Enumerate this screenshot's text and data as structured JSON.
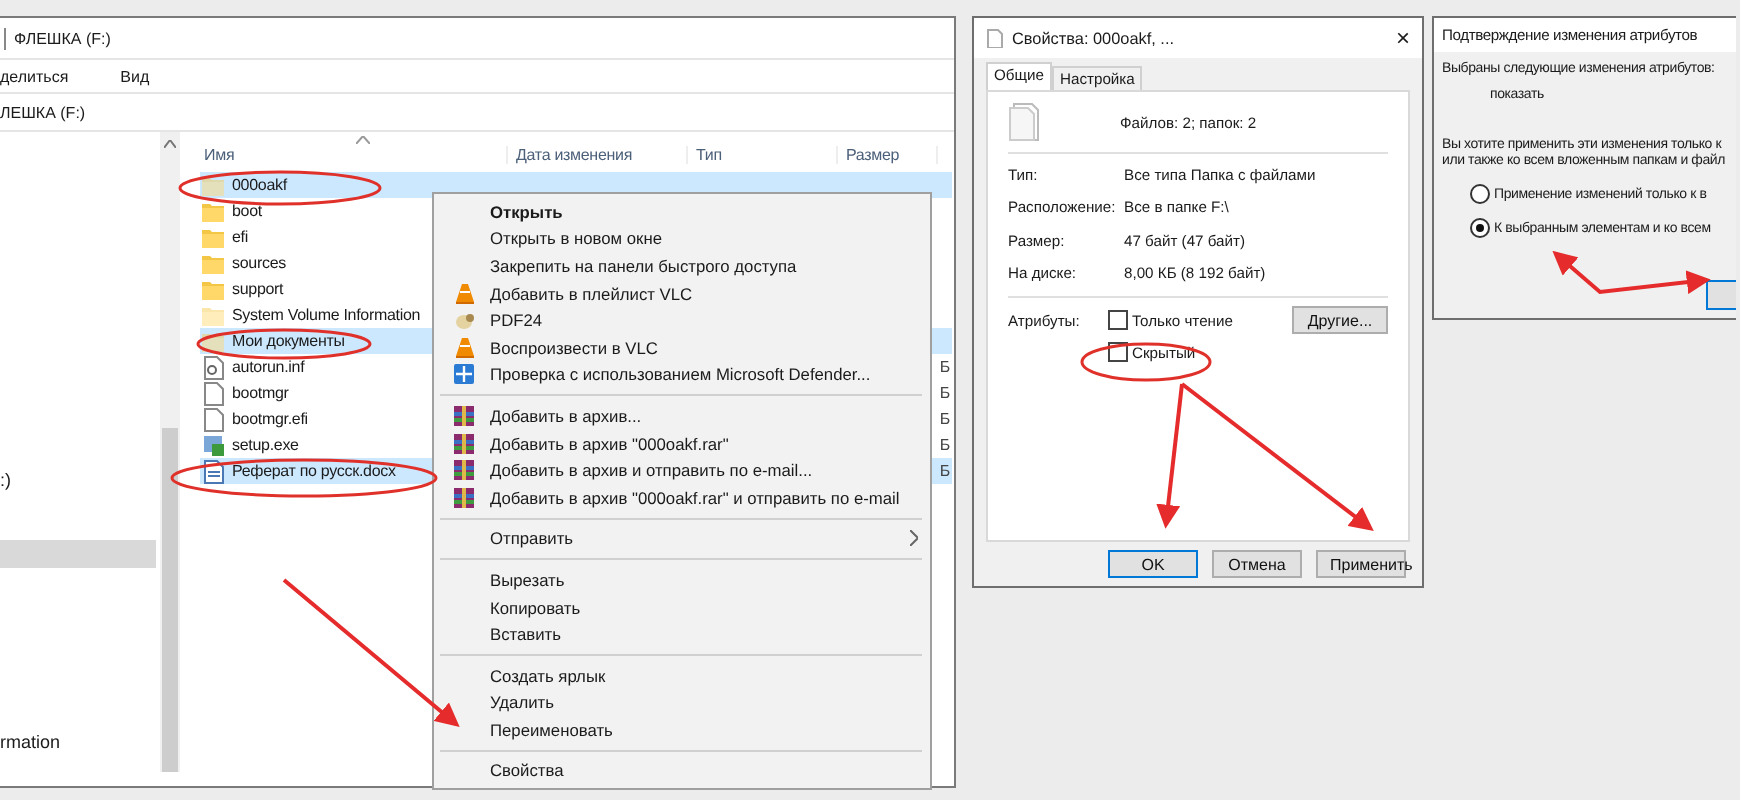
{
  "explorer": {
    "title": "ФЛЕШКА (F:)",
    "ribbon_tabs": [
      "делиться",
      "Вид"
    ],
    "address": "ЛЕШКА (F:)",
    "nav_items": [
      {
        "label": ":)",
        "selected": false
      },
      {
        "selected": true
      },
      {
        "label": "rmation",
        "selected": false
      }
    ],
    "columns": [
      "Имя",
      "Дата изменения",
      "Тип",
      "Размер"
    ],
    "files": [
      {
        "name": "000oakf",
        "kind": "folder",
        "hidden": true,
        "selected": true
      },
      {
        "name": "boot",
        "kind": "folder",
        "hidden": false,
        "selected": false
      },
      {
        "name": "efi",
        "kind": "folder",
        "hidden": false,
        "selected": false
      },
      {
        "name": "sources",
        "kind": "folder",
        "hidden": false,
        "selected": false
      },
      {
        "name": "support",
        "kind": "folder",
        "hidden": false,
        "selected": false
      },
      {
        "name": "System Volume Information",
        "kind": "folder",
        "hidden": true,
        "selected": false
      },
      {
        "name": "Мои документы",
        "kind": "folder",
        "hidden": true,
        "selected": true
      },
      {
        "name": "autorun.inf",
        "kind": "inf",
        "hidden": false,
        "selected": false,
        "size": "Б"
      },
      {
        "name": "bootmgr",
        "kind": "file",
        "hidden": false,
        "selected": false,
        "size": "Б"
      },
      {
        "name": "bootmgr.efi",
        "kind": "file",
        "hidden": false,
        "selected": false,
        "size": "Б"
      },
      {
        "name": "setup.exe",
        "kind": "exe",
        "hidden": false,
        "selected": false,
        "size": "Б"
      },
      {
        "name": "Реферат по русск.docx",
        "kind": "docx",
        "hidden": false,
        "selected": true,
        "size": "Б"
      }
    ]
  },
  "context_menu": {
    "items": [
      {
        "kind": "plain",
        "label": "Открыть",
        "default": true
      },
      {
        "kind": "plain",
        "label": "Открыть в новом окне",
        "default": false
      },
      {
        "kind": "plain",
        "label": "Закрепить на панели быстрого доступа",
        "default": false
      },
      {
        "kind": "cone",
        "label": "Добавить в плейлист VLC",
        "default": false
      },
      {
        "kind": "pdf",
        "label": "PDF24",
        "default": false
      },
      {
        "kind": "cone",
        "label": "Воспроизвести в VLC",
        "default": false
      },
      {
        "kind": "shield",
        "label": "Проверка с использованием Microsoft Defender...",
        "default": false
      },
      {
        "kind": "separator"
      },
      {
        "kind": "archive",
        "label": "Добавить в архив...",
        "default": false
      },
      {
        "kind": "archive",
        "label": "Добавить в архив \"000oakf.rar\"",
        "default": false
      },
      {
        "kind": "archive",
        "label": "Добавить в архив и отправить по e-mail...",
        "default": false
      },
      {
        "kind": "archive",
        "label": "Добавить в архив \"000oakf.rar\" и отправить по e-mail",
        "default": false
      },
      {
        "kind": "separator"
      },
      {
        "kind": "submenu",
        "label": "Отправить",
        "default": false
      },
      {
        "kind": "separator"
      },
      {
        "kind": "plain",
        "label": "Вырезать",
        "default": false
      },
      {
        "kind": "plain",
        "label": "Копировать",
        "default": false
      },
      {
        "kind": "plain",
        "label": "Вставить",
        "default": false
      },
      {
        "kind": "separator"
      },
      {
        "kind": "plain",
        "label": "Создать ярлык",
        "default": false
      },
      {
        "kind": "plain",
        "label": "Удалить",
        "default": false
      },
      {
        "kind": "plain",
        "label": "Переименовать",
        "default": false
      },
      {
        "kind": "separator"
      },
      {
        "kind": "plain",
        "label": "Свойства",
        "default": false
      }
    ]
  },
  "properties": {
    "title": "Свойства: 000oakf, ...",
    "close": "×",
    "tabs": [
      {
        "label": "Общие",
        "selected": true
      },
      {
        "label": "Настройка",
        "selected": false
      }
    ],
    "summary": "Файлов: 2; папок: 2",
    "fields": [
      {
        "label": "Тип:",
        "value": "Все типа Папка с файлами"
      },
      {
        "label": "Расположение:",
        "value": "Все в папке F:\\"
      },
      {
        "label": "Размер:",
        "value": "47 байт (47 байт)"
      },
      {
        "label": "На диске:",
        "value": "8,00 КБ (8 192 байт)"
      }
    ],
    "attributes_label": "Атрибуты:",
    "attributes": [
      {
        "label": "Только чтение",
        "checked": false
      },
      {
        "label": "Скрытый",
        "checked": false
      }
    ],
    "other_button": "Другие...",
    "buttons": [
      {
        "label": "OK",
        "default": true
      },
      {
        "label": "Отмена",
        "default": false
      },
      {
        "label": "Применить",
        "default": false
      }
    ]
  },
  "confirm": {
    "title": "Подтверждение изменения атрибутов",
    "intro": "Выбраны следующие изменения атрибутов:",
    "change": "показать",
    "question": [
      "Вы хотите применить эти изменения только к",
      "или также ко всем вложенным папкам и файл"
    ],
    "options": [
      {
        "label": "Применение изменений только к в",
        "selected": false
      },
      {
        "label": "К выбранным элементам и ко всем",
        "selected": true
      }
    ]
  }
}
